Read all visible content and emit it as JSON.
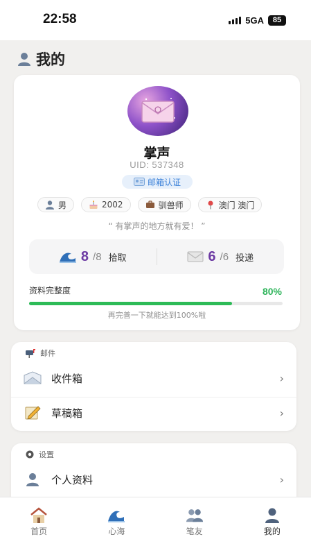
{
  "status_bar": {
    "time": "22:58",
    "network": "5GA",
    "battery": "85"
  },
  "header": {
    "title": "我的",
    "icon": "person-icon"
  },
  "profile": {
    "avatar_icon": "envelope-icon",
    "nickname": "掌声",
    "uid": "UID: 537348",
    "verify_label": "邮箱认证",
    "tags": [
      {
        "icon": "person-icon",
        "label": "男"
      },
      {
        "icon": "cake-icon",
        "label": "2002"
      },
      {
        "icon": "briefcase-icon",
        "label": "驯兽师"
      },
      {
        "icon": "pin-icon",
        "label": "澳门 澳门"
      }
    ],
    "motto": "“ 有掌声的地方就有爱！ ”",
    "stats": [
      {
        "icon": "wave-icon",
        "count": "8",
        "total": "/8",
        "label": "拾取"
      },
      {
        "icon": "mail-icon",
        "count": "6",
        "total": "/6",
        "label": "投递"
      }
    ],
    "completeness": {
      "label": "资料完整度",
      "value": "80%",
      "fraction": 0.8,
      "hint": "再完善一下就能达到100%啦"
    }
  },
  "mail_section": {
    "title": "邮件",
    "icon": "mailbox-icon",
    "items": [
      {
        "label": "收件箱",
        "icon": "inbox-icon"
      },
      {
        "label": "草稿箱",
        "icon": "draft-icon"
      }
    ]
  },
  "settings_section": {
    "title": "设置",
    "icon": "gear-icon",
    "items": [
      {
        "label": "个人资料",
        "icon": "person-icon"
      }
    ]
  },
  "tabbar": [
    {
      "label": "首页",
      "icon": "house-icon"
    },
    {
      "label": "心海",
      "icon": "wave-icon"
    },
    {
      "label": "笔友",
      "icon": "people-icon"
    },
    {
      "label": "我的",
      "icon": "person-icon",
      "active": true
    }
  ],
  "colors": {
    "accent": "#6c3aa3",
    "progress": "#2dbb57",
    "verify": "#3d82d9"
  }
}
